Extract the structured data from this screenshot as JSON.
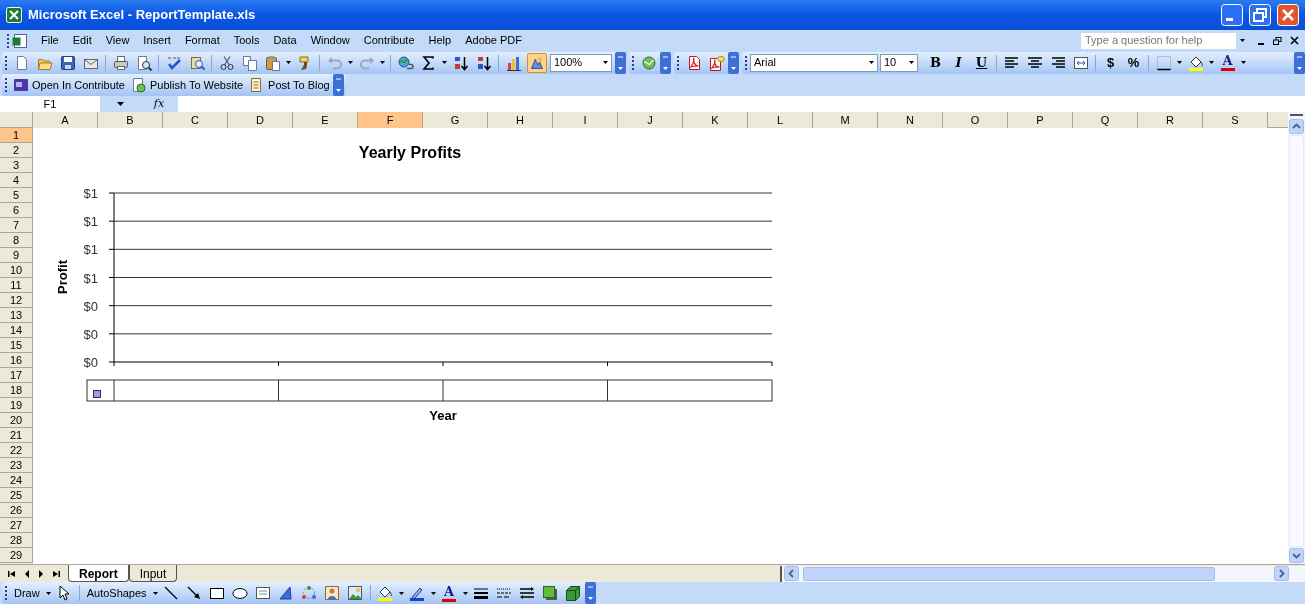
{
  "window": {
    "title": "Microsoft Excel - ReportTemplate.xls"
  },
  "menu": [
    "File",
    "Edit",
    "View",
    "Insert",
    "Format",
    "Tools",
    "Data",
    "Window",
    "Contribute",
    "Help",
    "Adobe PDF"
  ],
  "help_box": {
    "placeholder": "Type a question for help"
  },
  "standard_toolbar": {
    "drawing_on": true,
    "zoom": "100%"
  },
  "formatting_toolbar": {
    "font": "Arial",
    "size": "10",
    "buttons": [
      "B",
      "I",
      "U"
    ],
    "number_buttons": [
      "$",
      "%"
    ],
    "font_color": "A"
  },
  "contribute_toolbar": {
    "buttons": [
      "Open In Contribute",
      "Publish To Website",
      "Post To Blog"
    ]
  },
  "formula_bar": {
    "name_box": "F1",
    "function_label": "fx"
  },
  "columns": [
    {
      "label": "A",
      "selected": false
    },
    {
      "label": "B",
      "selected": false
    },
    {
      "label": "C",
      "selected": false
    },
    {
      "label": "D",
      "selected": false
    },
    {
      "label": "E",
      "selected": false
    },
    {
      "label": "F",
      "selected": true
    },
    {
      "label": "G",
      "selected": false
    },
    {
      "label": "H",
      "selected": false
    },
    {
      "label": "I",
      "selected": false
    },
    {
      "label": "J",
      "selected": false
    },
    {
      "label": "K",
      "selected": false
    },
    {
      "label": "L",
      "selected": false
    },
    {
      "label": "M",
      "selected": false
    },
    {
      "label": "N",
      "selected": false
    },
    {
      "label": "O",
      "selected": false
    },
    {
      "label": "P",
      "selected": false
    },
    {
      "label": "Q",
      "selected": false
    },
    {
      "label": "R",
      "selected": false
    },
    {
      "label": "S",
      "selected": false
    }
  ],
  "rows": [
    {
      "label": "1",
      "selected": true
    },
    {
      "label": "2",
      "selected": false
    },
    {
      "label": "3",
      "selected": false
    },
    {
      "label": "4",
      "selected": false
    },
    {
      "label": "5",
      "selected": false
    },
    {
      "label": "6",
      "selected": false
    },
    {
      "label": "7",
      "selected": false
    },
    {
      "label": "8",
      "selected": false
    },
    {
      "label": "9",
      "selected": false
    },
    {
      "label": "10",
      "selected": false
    },
    {
      "label": "11",
      "selected": false
    },
    {
      "label": "12",
      "selected": false
    },
    {
      "label": "13",
      "selected": false
    },
    {
      "label": "14",
      "selected": false
    },
    {
      "label": "15",
      "selected": false
    },
    {
      "label": "16",
      "selected": false
    },
    {
      "label": "17",
      "selected": false
    },
    {
      "label": "18",
      "selected": false
    },
    {
      "label": "19",
      "selected": false
    },
    {
      "label": "20",
      "selected": false
    },
    {
      "label": "21",
      "selected": false
    },
    {
      "label": "22",
      "selected": false
    },
    {
      "label": "23",
      "selected": false
    },
    {
      "label": "24",
      "selected": false
    },
    {
      "label": "25",
      "selected": false
    },
    {
      "label": "26",
      "selected": false
    },
    {
      "label": "27",
      "selected": false
    },
    {
      "label": "28",
      "selected": false
    },
    {
      "label": "29",
      "selected": false
    }
  ],
  "chart": {
    "chart_data": {
      "type": "bar",
      "grid": true,
      "title": "Yearly Profits",
      "xlabel": "Year",
      "ylabel": "Profit",
      "series": [
        {
          "color": "#9999ff",
          "values": [
            null,
            null,
            null,
            null
          ]
        }
      ],
      "ylim": [
        0,
        1.2
      ],
      "yticks": [
        {
          "value": 0,
          "label": "$0"
        },
        {
          "value": 0.2,
          "label": "$0"
        },
        {
          "value": 0.4,
          "label": "$0"
        },
        {
          "value": 0.6,
          "label": "$1"
        },
        {
          "value": 0.8,
          "label": "$1"
        },
        {
          "value": 1,
          "label": "$1"
        },
        {
          "value": 1.2,
          "label": "$1"
        }
      ]
    }
  },
  "sheet_tabs": [
    {
      "label": "Report",
      "selected": true
    },
    {
      "label": "Input",
      "selected": false
    }
  ],
  "drawing_toolbar": {
    "draw": "Draw",
    "autoshapes": "AutoShapes",
    "font_color": "A"
  }
}
